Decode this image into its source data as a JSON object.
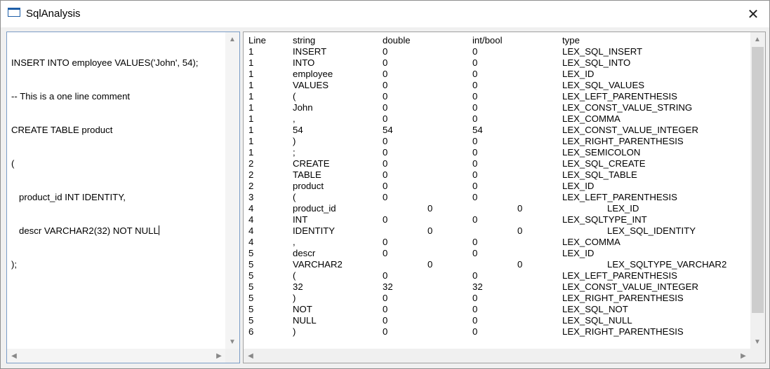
{
  "window": {
    "title": "SqlAnalysis",
    "close_glyph": "✕"
  },
  "editor": {
    "lines": [
      "INSERT INTO employee VALUES('John', 54);",
      "-- This is a one line comment",
      "CREATE TABLE product",
      "(",
      "   product_id INT IDENTITY,",
      "   descr VARCHAR2(32) NOT NULL",
      ");"
    ]
  },
  "tokens": {
    "headers": [
      "Line",
      "string",
      "double",
      "int/bool",
      "type"
    ],
    "rows": [
      [
        "1",
        "INSERT",
        "0",
        "0",
        "LEX_SQL_INSERT"
      ],
      [
        "1",
        "INTO",
        "0",
        "0",
        "LEX_SQL_INTO"
      ],
      [
        "1",
        "employee",
        "0",
        "0",
        "LEX_ID"
      ],
      [
        "1",
        "VALUES",
        "0",
        "0",
        "LEX_SQL_VALUES"
      ],
      [
        "1",
        "(",
        "0",
        "0",
        "LEX_LEFT_PARENTHESIS"
      ],
      [
        "1",
        "John",
        "0",
        "0",
        "LEX_CONST_VALUE_STRING"
      ],
      [
        "1",
        ",",
        "0",
        "0",
        "LEX_COMMA"
      ],
      [
        "1",
        "54",
        "54",
        "54",
        "LEX_CONST_VALUE_INTEGER"
      ],
      [
        "1",
        ")",
        "0",
        "0",
        "LEX_RIGHT_PARENTHESIS"
      ],
      [
        "1",
        ";",
        "0",
        "0",
        "LEX_SEMICOLON"
      ],
      [
        "2",
        "CREATE",
        "0",
        "0",
        "LEX_SQL_CREATE"
      ],
      [
        "2",
        "TABLE",
        "0",
        "0",
        "LEX_SQL_TABLE"
      ],
      [
        "2",
        "product",
        "0",
        "0",
        "LEX_ID"
      ],
      [
        "3",
        "(",
        "0",
        "0",
        "LEX_LEFT_PARENTHESIS"
      ],
      [
        "4",
        "product_id",
        "0",
        "0",
        "LEX_ID"
      ],
      [
        "4",
        "INT",
        "0",
        "0",
        "LEX_SQLTYPE_INT"
      ],
      [
        "4",
        "IDENTITY",
        "0",
        "0",
        "LEX_SQL_IDENTITY"
      ],
      [
        "4",
        ",",
        "0",
        "0",
        "LEX_COMMA"
      ],
      [
        "5",
        "descr",
        "0",
        "0",
        "LEX_ID"
      ],
      [
        "5",
        "VARCHAR2",
        "0",
        "0",
        "LEX_SQLTYPE_VARCHAR2"
      ],
      [
        "5",
        "(",
        "0",
        "0",
        "LEX_LEFT_PARENTHESIS"
      ],
      [
        "5",
        "32",
        "32",
        "32",
        "LEX_CONST_VALUE_INTEGER"
      ],
      [
        "5",
        ")",
        "0",
        "0",
        "LEX_RIGHT_PARENTHESIS"
      ],
      [
        "5",
        "NOT",
        "0",
        "0",
        "LEX_SQL_NOT"
      ],
      [
        "5",
        "NULL",
        "0",
        "0",
        "LEX_SQL_NULL"
      ],
      [
        "6",
        ")",
        "0",
        "0",
        "LEX_RIGHT_PARENTHESIS"
      ]
    ]
  },
  "colors": {
    "editor_border": "#7a9cc6",
    "app_icon": "#1f5fa8"
  }
}
